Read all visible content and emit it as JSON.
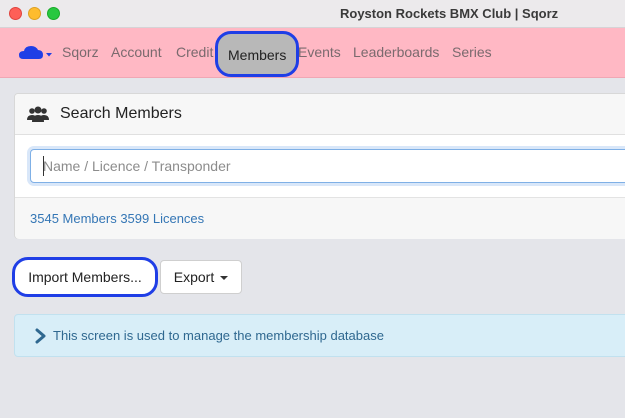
{
  "window": {
    "title": "Royston Rockets BMX Club | Sqorz"
  },
  "nav": {
    "brand_icon": "cloud-icon",
    "items": [
      {
        "label": "Sqorz"
      },
      {
        "label": "Account"
      },
      {
        "label": "Credit"
      },
      {
        "label": "Members"
      },
      {
        "label": "Events"
      },
      {
        "label": "Leaderboards"
      },
      {
        "label": "Series"
      }
    ],
    "active": "Members"
  },
  "search_panel": {
    "icon": "users-icon",
    "title": "Search Members",
    "input_placeholder": "Name / Licence / Transponder",
    "input_value": "",
    "counts": "3545 Members 3599 Licences"
  },
  "actions": {
    "import_label": "Import Members...",
    "export_label": "Export"
  },
  "info": {
    "icon": "chevron-right-icon",
    "text": "This screen is used to manage the membership database"
  },
  "colors": {
    "navbar": "#ffb8c4",
    "active_nav": "#b8b8b8",
    "highlight_ring": "#1f3ee6",
    "link": "#3476b5",
    "info_bg": "#d8eef8"
  }
}
